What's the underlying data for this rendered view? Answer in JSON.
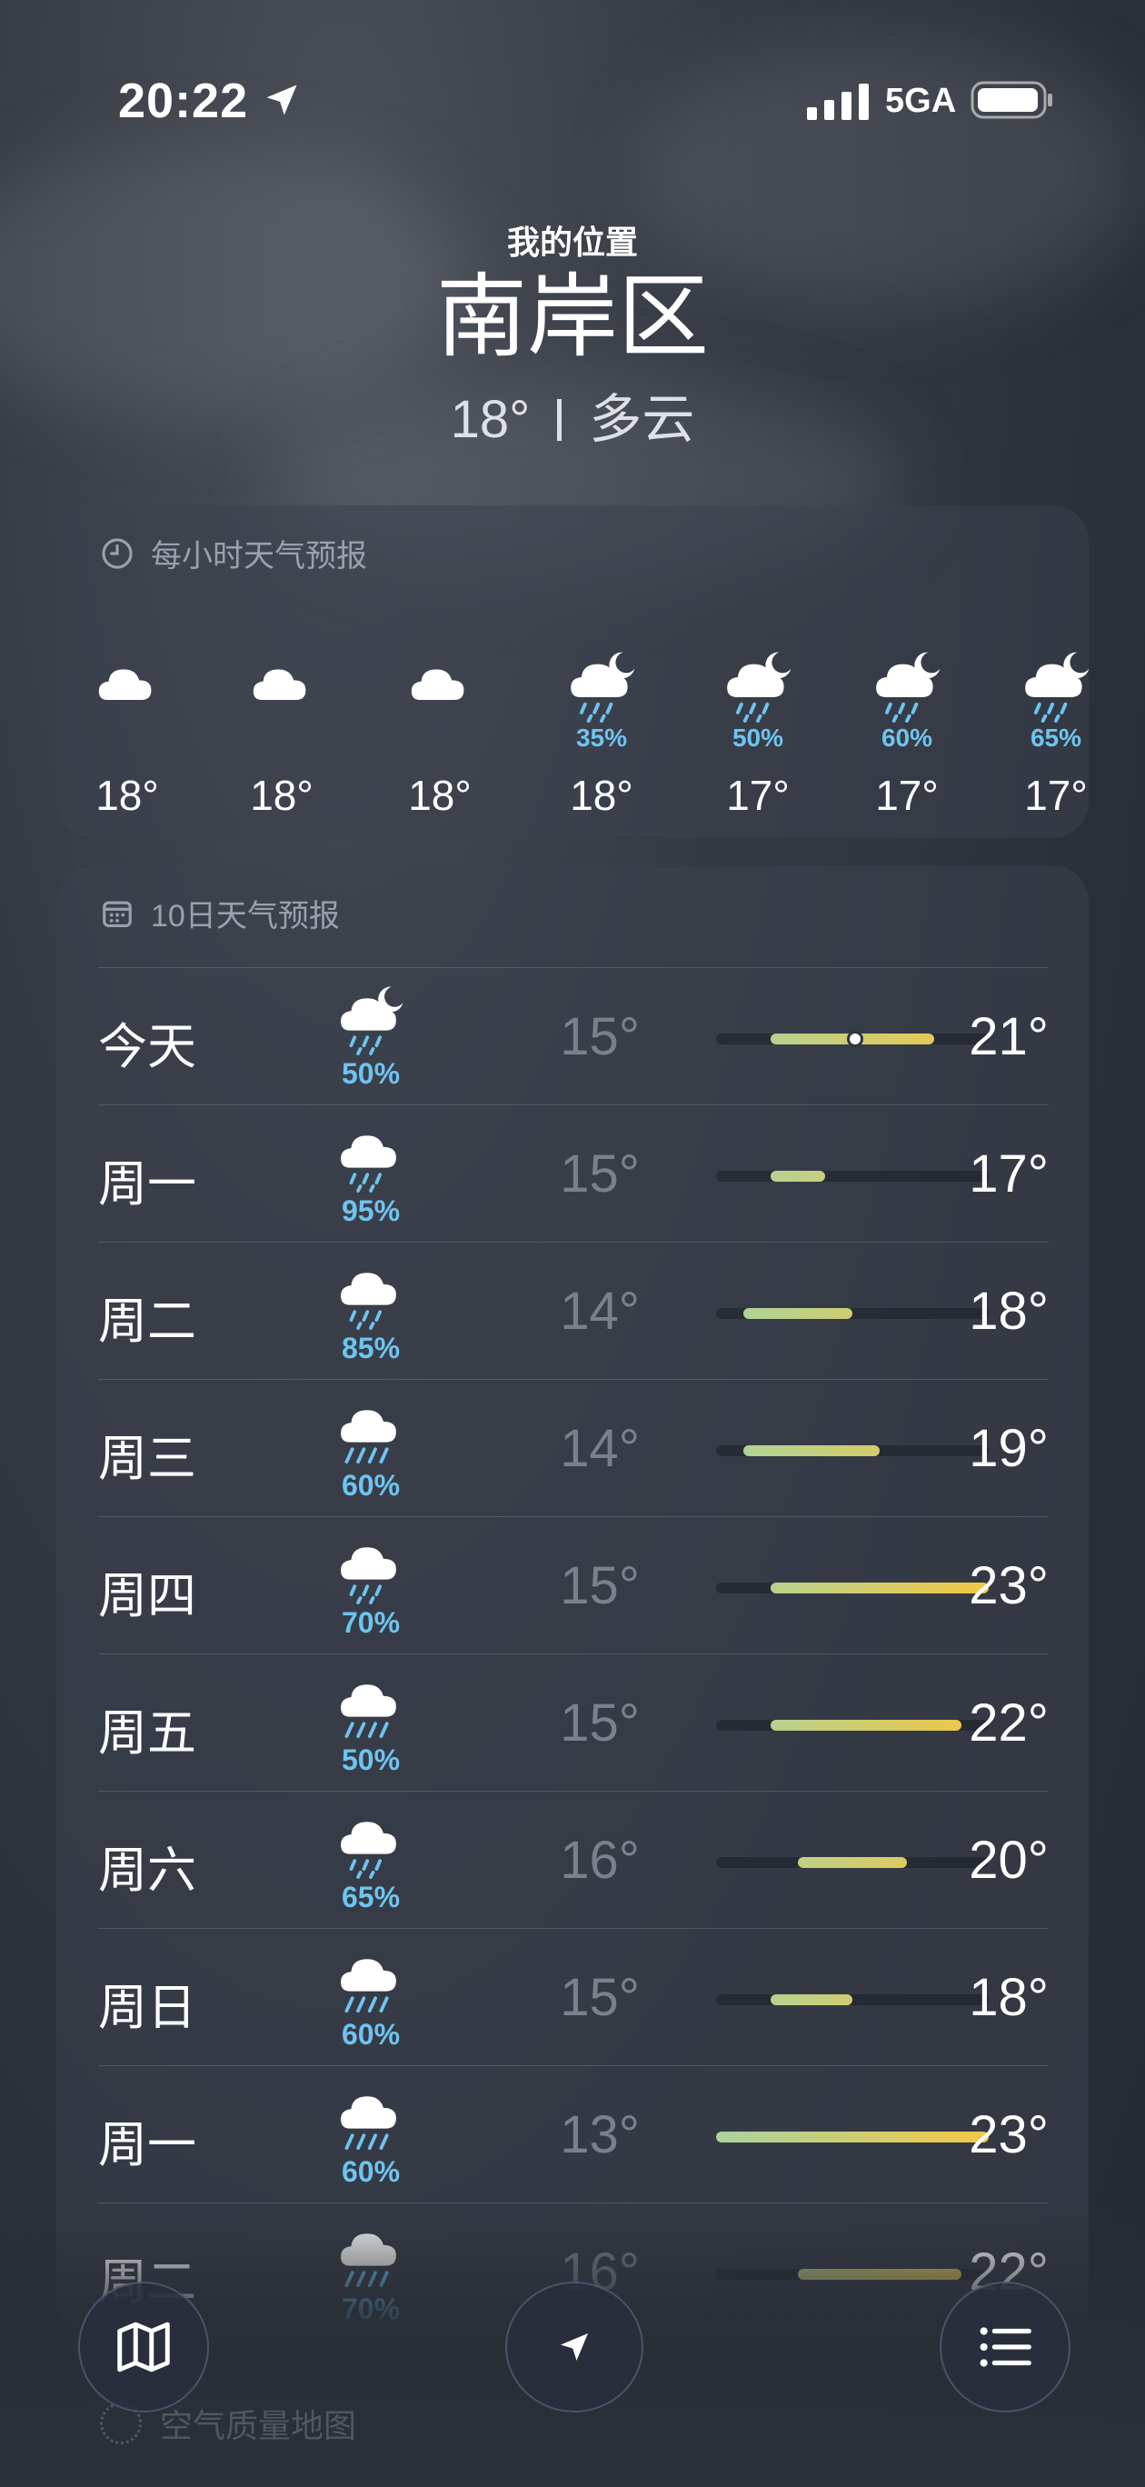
{
  "status": {
    "time": "20:22",
    "network": "5GA",
    "icons": [
      "location-arrow-icon",
      "signal-icon",
      "battery-icon"
    ]
  },
  "header": {
    "my_location": "我的位置",
    "city": "南岸区",
    "temp": "18°",
    "condition": "多云"
  },
  "hourly": {
    "title": "每小时天气预报",
    "items": [
      {
        "icon": "cloud-icon",
        "pct": "",
        "temp": "18°"
      },
      {
        "icon": "cloud-icon",
        "pct": "",
        "temp": "18°"
      },
      {
        "icon": "cloud-icon",
        "pct": "",
        "temp": "18°"
      },
      {
        "icon": "cloud-moon-rain-icon",
        "pct": "35%",
        "temp": "18°"
      },
      {
        "icon": "cloud-moon-rain-icon",
        "pct": "50%",
        "temp": "17°"
      },
      {
        "icon": "cloud-moon-rain-icon",
        "pct": "60%",
        "temp": "17°"
      },
      {
        "icon": "cloud-moon-rain-icon",
        "pct": "65%",
        "temp": "17°"
      }
    ]
  },
  "daily": {
    "title": "10日天气预报",
    "range_min": 13,
    "range_max": 23,
    "days": [
      {
        "name": "今天",
        "icon": "cloud-moon-rain-icon",
        "pct": "50%",
        "lo": "15°",
        "hi": "21°",
        "lo_v": 15,
        "hi_v": 21,
        "current": 18
      },
      {
        "name": "周一",
        "icon": "cloud-rain-icon",
        "pct": "95%",
        "lo": "15°",
        "hi": "17°",
        "lo_v": 15,
        "hi_v": 17
      },
      {
        "name": "周二",
        "icon": "cloud-rain-icon",
        "pct": "85%",
        "lo": "14°",
        "hi": "18°",
        "lo_v": 14,
        "hi_v": 18
      },
      {
        "name": "周三",
        "icon": "cloud-heavy-rain-icon",
        "pct": "60%",
        "lo": "14°",
        "hi": "19°",
        "lo_v": 14,
        "hi_v": 19
      },
      {
        "name": "周四",
        "icon": "cloud-rain-icon",
        "pct": "70%",
        "lo": "15°",
        "hi": "23°",
        "lo_v": 15,
        "hi_v": 23
      },
      {
        "name": "周五",
        "icon": "cloud-heavy-rain-icon",
        "pct": "50%",
        "lo": "15°",
        "hi": "22°",
        "lo_v": 15,
        "hi_v": 22
      },
      {
        "name": "周六",
        "icon": "cloud-rain-icon",
        "pct": "65%",
        "lo": "16°",
        "hi": "20°",
        "lo_v": 16,
        "hi_v": 20
      },
      {
        "name": "周日",
        "icon": "cloud-heavy-rain-icon",
        "pct": "60%",
        "lo": "15°",
        "hi": "18°",
        "lo_v": 15,
        "hi_v": 18
      },
      {
        "name": "周一",
        "icon": "cloud-heavy-rain-icon",
        "pct": "60%",
        "lo": "13°",
        "hi": "23°",
        "lo_v": 13,
        "hi_v": 23
      },
      {
        "name": "周二",
        "icon": "cloud-heavy-rain-icon",
        "pct": "70%",
        "lo": "16°",
        "hi": "22°",
        "lo_v": 16,
        "hi_v": 22
      }
    ]
  },
  "air_quality_map": {
    "title": "空气质量地图"
  },
  "toolbar": {
    "map": "map-icon",
    "location": "location-arrow-icon",
    "list": "list-icon"
  },
  "colors": {
    "pct_blue": "#6ec4f0",
    "bar_cool": "#a9d4a0",
    "bar_warm": "#f2c744",
    "bar_mid": "#d7dc7a"
  }
}
